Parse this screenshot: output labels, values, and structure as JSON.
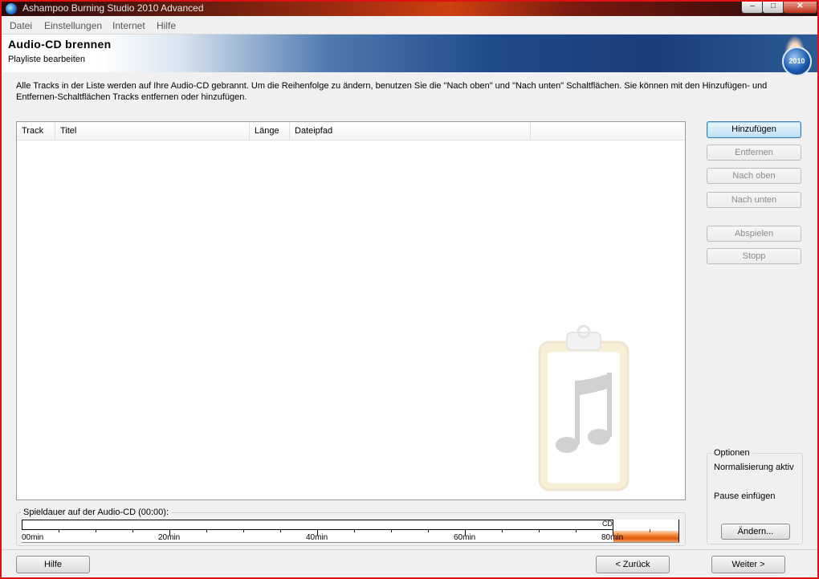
{
  "window": {
    "title": "Ashampoo Burning Studio 2010 Advanced",
    "controls": {
      "minimize": "–",
      "maximize": "□",
      "close": "✕"
    }
  },
  "menu": [
    "Datei",
    "Einstellungen",
    "Internet",
    "Hilfe"
  ],
  "header": {
    "title": "Audio-CD brennen",
    "subtitle": "Playliste bearbeiten",
    "logo_badge": "2010"
  },
  "description": {
    "line1": "Alle Tracks in der Liste werden auf Ihre Audio-CD gebrannt. Um die Reihenfolge zu ändern, benutzen Sie die \"Nach oben\" und \"Nach unten\" Schaltflächen. Sie können mit den Hinzufügen- und",
    "line2": "Entfernen-Schaltflächen Tracks entfernen oder hinzufügen."
  },
  "tracklist": {
    "columns": [
      "Track",
      "Titel",
      "Länge",
      "Dateipfad"
    ],
    "rows": []
  },
  "actions": {
    "add": "Hinzufügen",
    "remove": "Entfernen",
    "move_up": "Nach oben",
    "move_down": "Nach unten",
    "play": "Abspielen",
    "stop": "Stopp"
  },
  "options": {
    "title": "Optionen",
    "normalize": "Normalisierung aktiv",
    "pause": "Pause einfügen",
    "change_button": "Ändern..."
  },
  "duration": {
    "label": "Spieldauer auf der Audio-CD (00:00):",
    "medium_label": "CD",
    "scale_labels": [
      "00min",
      "20min",
      "40min",
      "60min",
      "80min"
    ],
    "scale_max_min": 89,
    "cd_capacity_min": 80,
    "used_min": 0
  },
  "footer": {
    "help": "Hilfe",
    "back": "< Zurück",
    "next": "Weiter >"
  },
  "colors": {
    "frame_border": "#dd1111",
    "overflow_orange": "#f07a2a"
  }
}
